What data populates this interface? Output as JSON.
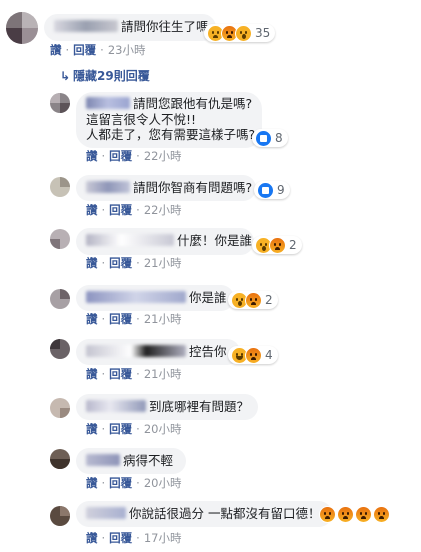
{
  "top_comment": {
    "text": "請問你往生了嗎",
    "reaction_count": "35",
    "reactions": [
      "sad",
      "angry",
      "wow"
    ],
    "actions": {
      "like": "讚",
      "reply": "回覆",
      "time": "23小時"
    }
  },
  "hidden_replies": {
    "label": "隱藏29則回覆",
    "icon": "reply-arrow-icon"
  },
  "replies": [
    {
      "lines": [
        "請問您跟他有仇是嗎?",
        "這留言很令人不悅!!",
        "人都走了，您有需要這樣子嗎?"
      ],
      "reaction_count": "8",
      "reactions": [
        "like"
      ],
      "actions": {
        "like": "讚",
        "reply": "回覆",
        "time": "22小時"
      }
    },
    {
      "lines": [
        "請問你智商有問題嗎?"
      ],
      "reaction_count": "9",
      "reactions": [
        "like"
      ],
      "actions": {
        "like": "讚",
        "reply": "回覆",
        "time": "22小時"
      }
    },
    {
      "lines": [
        "什麼！你是誰"
      ],
      "reaction_count": "2",
      "reactions": [
        "wow",
        "angry"
      ],
      "actions": {
        "like": "讚",
        "reply": "回覆",
        "time": "21小時"
      }
    },
    {
      "lines": [
        "你是誰"
      ],
      "reaction_count": "2",
      "reactions": [
        "wow",
        "angry"
      ],
      "actions": {
        "like": "讚",
        "reply": "回覆",
        "time": "21小時"
      }
    },
    {
      "lines": [
        "控告你"
      ],
      "reaction_count": "4",
      "reactions": [
        "haha",
        "angry"
      ],
      "actions": {
        "like": "讚",
        "reply": "回覆",
        "time": "21小時"
      }
    },
    {
      "lines": [
        "到底哪裡有問題？"
      ],
      "reaction_count": "",
      "reactions": [],
      "actions": {
        "like": "讚",
        "reply": "回覆",
        "time": "20小時"
      }
    },
    {
      "lines": [
        "病得不輕"
      ],
      "reaction_count": "",
      "reactions": [],
      "actions": {
        "like": "讚",
        "reply": "回覆",
        "time": "20小時"
      }
    },
    {
      "lines": [
        "你說話很過分 一點都沒有留口德！"
      ],
      "reaction_count": "",
      "reactions": [
        "angry",
        "angry",
        "angry",
        "angry"
      ],
      "actions": {
        "like": "讚",
        "reply": "回覆",
        "time": "17小時"
      }
    }
  ],
  "colors": {
    "link": "#385898",
    "bubble": "#f2f3f5",
    "meta": "#90949c"
  }
}
